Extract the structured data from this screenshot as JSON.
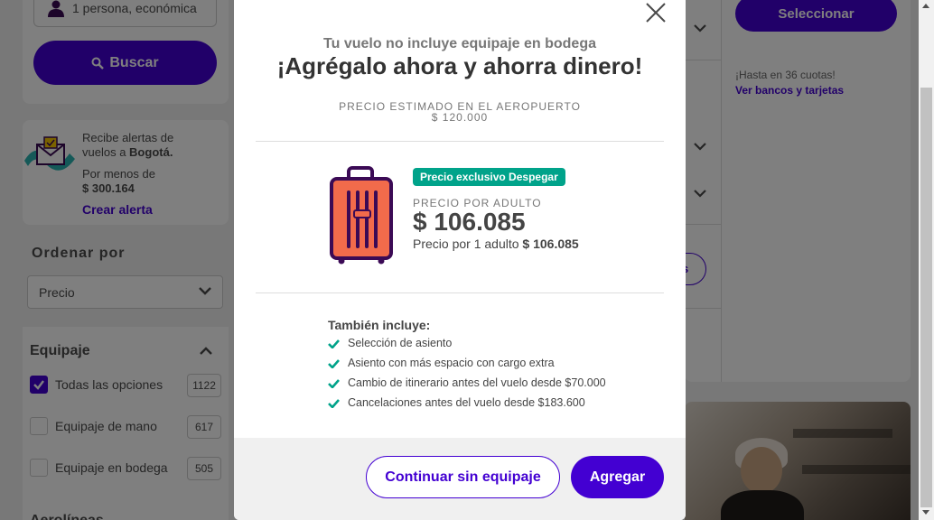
{
  "background": {
    "passenger_field": "1 persona, económica",
    "search_button": "Buscar",
    "alert": {
      "line1": "Recibe alertas de",
      "line2_prefix": "vuelos a ",
      "line2_city": "Bogotá.",
      "line3": "Por menos de",
      "amount": "$ 300.164",
      "link": "Crear alerta"
    },
    "order_by": {
      "label": "Ordenar por",
      "selected": "Precio"
    },
    "luggage_filter": {
      "title": "Equipaje",
      "options": [
        {
          "label": "Todas las opciones",
          "count": "1122",
          "checked": true
        },
        {
          "label": "Equipaje de mano",
          "count": "617",
          "checked": false
        },
        {
          "label": "Equipaje en bodega",
          "count": "505",
          "checked": false
        }
      ]
    },
    "airlines_label": "Aerolíneas",
    "select_button": "Seleccionar",
    "installments": "¡Hasta en 36 cuotas!",
    "banks_link": "Ver bancos y tarjetas",
    "pill_fragment": "s"
  },
  "modal": {
    "subtitle": "Tu vuelo no incluye equipaje en bodega",
    "title": "¡Agrégalo ahora y ahorra dinero!",
    "airport_price_label": "PRECIO ESTIMADO EN EL AEROPUERTO",
    "airport_price_value": "$ 120.000",
    "badge": "Precio exclusivo Despegar",
    "adult_price_label": "PRECIO POR ADULTO",
    "adult_price": "$ 106.085",
    "per_adult_prefix": "Precio por 1 adulto ",
    "per_adult_value": "$ 106.085",
    "includes_title": "También incluye:",
    "includes": [
      "Selección de asiento",
      "Asiento con más espacio con cargo extra",
      "Cambio de itinerario antes del vuelo desde $70.000",
      "Cancelaciones antes del vuelo desde $183.600"
    ],
    "skip_button": "Continuar sin equipaje",
    "add_button": "Agregar"
  },
  "colors": {
    "brand": "#4300d2",
    "badge": "#00a38a",
    "check": "#00a38a",
    "suitcase_body": "#f26b4b",
    "suitcase_outline": "#3b0a55"
  }
}
